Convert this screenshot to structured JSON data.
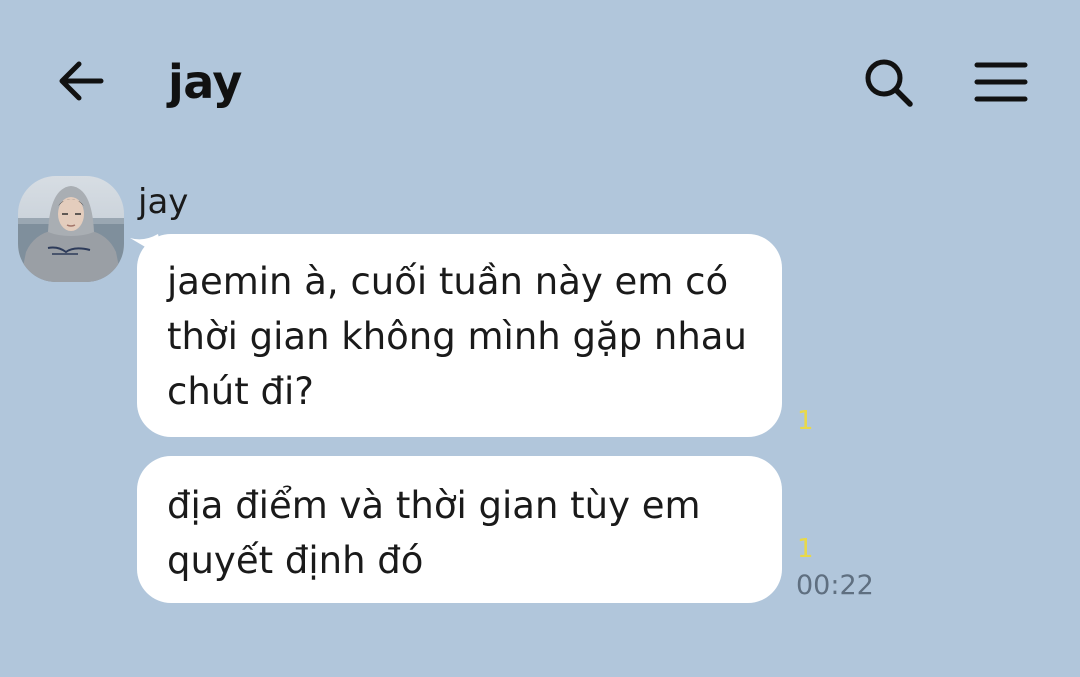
{
  "header": {
    "title": "jay",
    "back_icon": "arrow-left-icon",
    "search_icon": "search-icon",
    "menu_icon": "hamburger-menu-icon"
  },
  "conversation": {
    "sender_name": "jay",
    "messages": [
      {
        "text": "jaemin à, cuối tuần này em có\nthời gian không mình gặp nhau\nchút đi?",
        "unread_count": "1"
      },
      {
        "text": "địa điểm và thời gian tùy em\nquyết định đó",
        "unread_count": "1",
        "time": "00:22"
      }
    ]
  },
  "colors": {
    "background": "#b1c6db",
    "bubble": "#ffffff",
    "unread": "#e8d94a",
    "timestamp": "#5f6f80"
  }
}
